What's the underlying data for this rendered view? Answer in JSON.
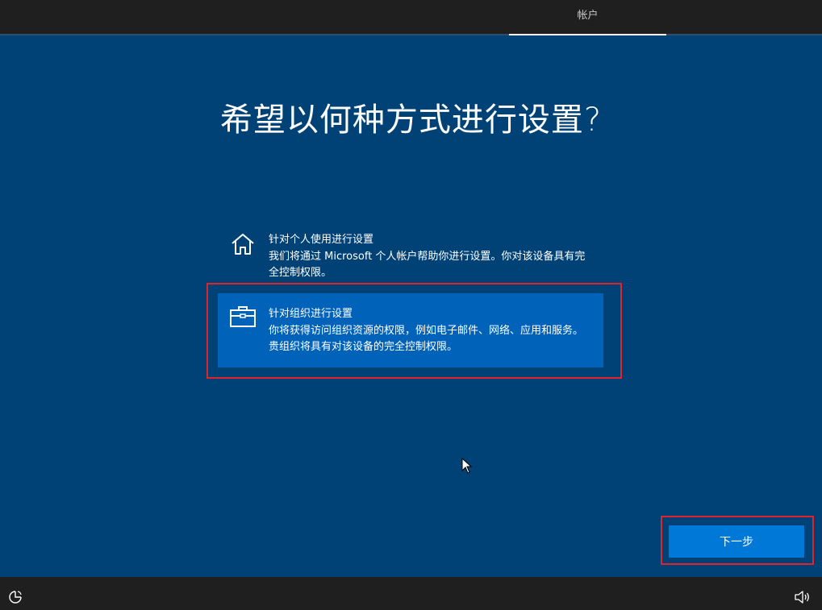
{
  "top_bar": {
    "tab_label": "帐户"
  },
  "page": {
    "title": "希望以何种方式进行设置?"
  },
  "options": [
    {
      "icon": "home-icon",
      "title": "针对个人使用进行设置",
      "description": "我们将通过 Microsoft 个人帐户帮助你进行设置。你对该设备具有完全控制权限。",
      "selected": false
    },
    {
      "icon": "briefcase-icon",
      "title": "针对组织进行设置",
      "description": "你将获得访问组织资源的权限，例如电子邮件、网络、应用和服务。贵组织将具有对该设备的完全控制权限。",
      "selected": true
    }
  ],
  "buttons": {
    "next_label": "下一步"
  },
  "bottom_bar": {
    "left_icon": "ease-of-access-icon",
    "right_icon": "volume-icon"
  },
  "colors": {
    "background": "#004275",
    "bar": "#1f1f1f",
    "selected_option": "#0062b8",
    "primary_button": "#0078d7",
    "highlight_box": "#e0242b"
  }
}
